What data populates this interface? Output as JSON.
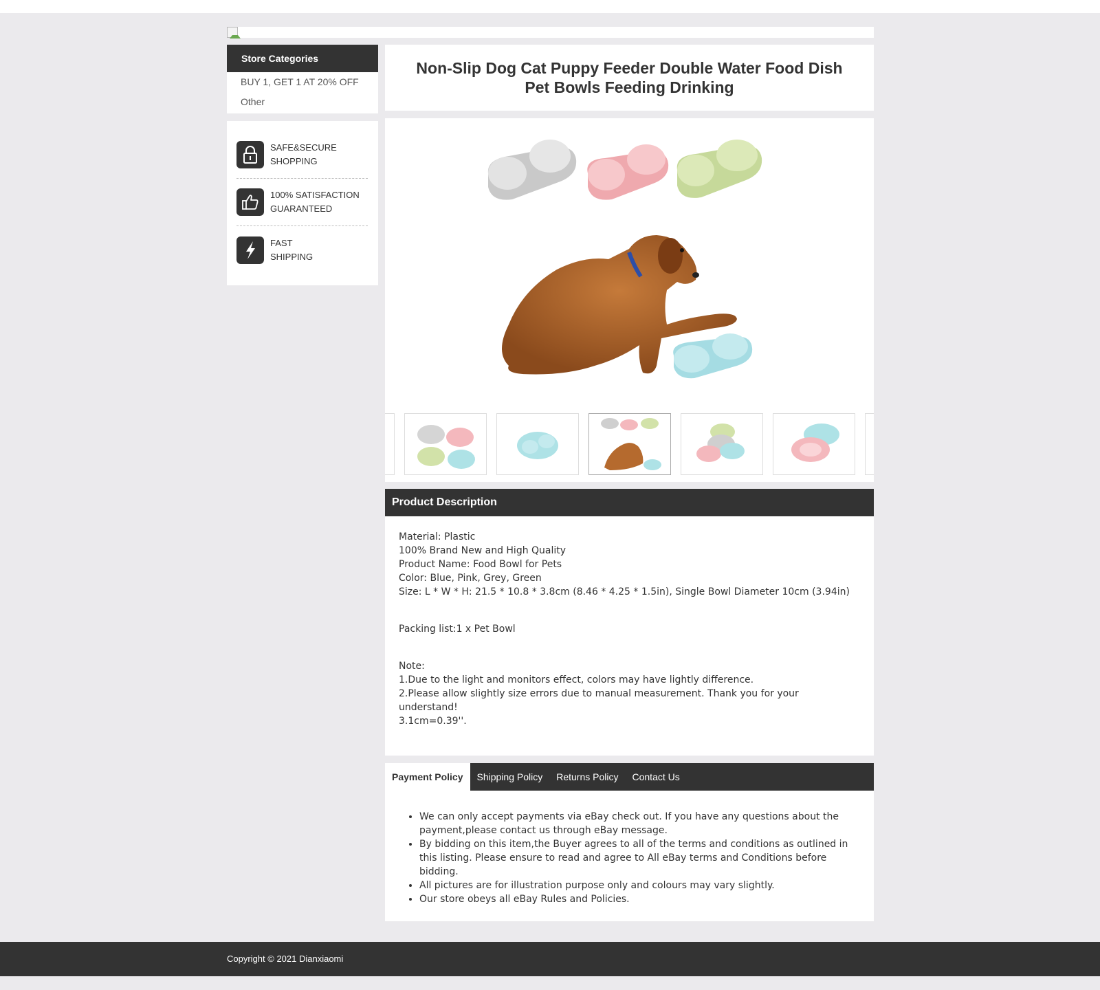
{
  "sidebar": {
    "categories_title": "Store Categories",
    "categories": [
      "BUY 1, GET 1 AT 20% OFF",
      "Other"
    ],
    "trust": [
      {
        "icon": "lock-icon",
        "line1": "SAFE&SECURE",
        "line2": "SHOPPING"
      },
      {
        "icon": "thumbs-up-icon",
        "line1": "100% SATISFACTION",
        "line2": "GUARANTEED"
      },
      {
        "icon": "lightning-icon",
        "line1": "FAST",
        "line2": "SHIPPING"
      }
    ]
  },
  "product": {
    "title": "Non-Slip Dog Cat Puppy Feeder Double Water Food Dish Pet Bowls Feeding Drinking"
  },
  "gallery": {
    "bowl_colors": {
      "grey": "#d5d5d5",
      "pink": "#f4b8bd",
      "green": "#d2e2a9",
      "blue": "#aee2e6"
    }
  },
  "description": {
    "heading": "Product Description",
    "lines": [
      "Material: Plastic",
      "100% Brand New and High Quality",
      "Product Name: Food Bowl for Pets",
      "Color: Blue, Pink, Grey, Green",
      "Size: L * W * H: 21.5 * 10.8 * 3.8cm (8.46 * 4.25 * 1.5in), Single Bowl Diameter 10cm (3.94in)"
    ],
    "packing": "Packing list:1 x Pet Bowl",
    "note_title": "Note:",
    "notes": [
      "1.Due to the light and monitors effect, colors may have lightly difference.",
      "2.Please allow slightly size errors due to manual measurement. Thank you for your understand!",
      "3.1cm=0.39''."
    ]
  },
  "policy": {
    "tabs": [
      "Payment Policy",
      "Shipping Policy",
      "Returns Policy",
      "Contact Us"
    ],
    "items": [
      "We can only accept payments via eBay check out. If you have any questions about the payment,please contact us through eBay message.",
      "By bidding on this item,the Buyer agrees to all of the terms and conditions as outlined in this listing. Please ensure to read and agree to All eBay terms and Conditions before bidding.",
      "All pictures are for illustration purpose only and colours may vary slightly.",
      "Our store obeys all eBay Rules and Policies."
    ]
  },
  "footer": {
    "copyright": "Copyright © 2021 Dianxiaomi"
  }
}
